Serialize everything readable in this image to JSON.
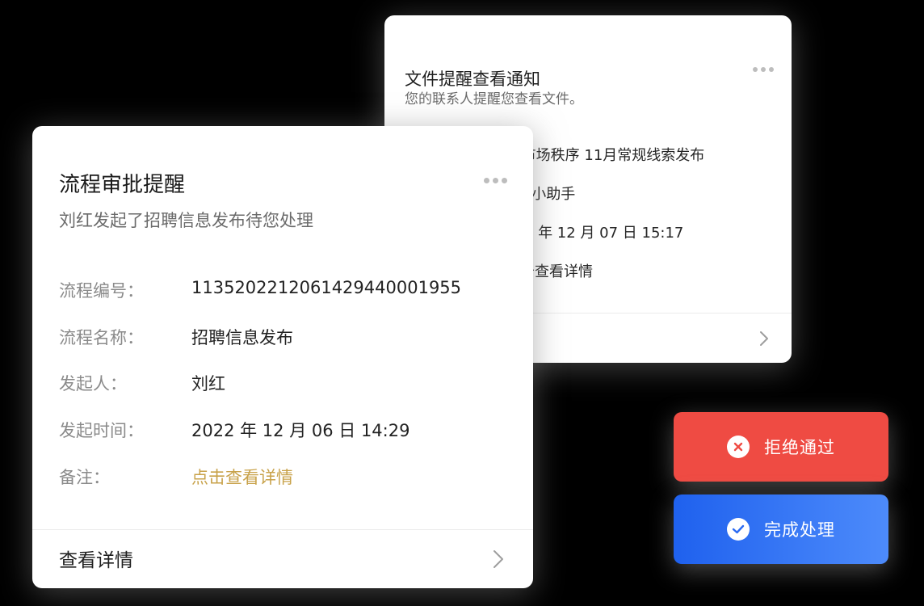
{
  "file_card": {
    "title": "文件提醒查看通知",
    "subtitle": "您的联系人提醒您查看文件。",
    "rows": [
      "G 市场秩序 11月常规线索发布",
      "CG 小助手",
      "022 年 12 月 07 日 15:17",
      "点击查看详情"
    ]
  },
  "approval_card": {
    "title": "流程审批提醒",
    "subtitle": "刘红发起了招聘信息发布待您处理",
    "fields": [
      {
        "label": "流程编号：",
        "value": "1135202212061429440001955"
      },
      {
        "label": "流程名称：",
        "value": "招聘信息发布"
      },
      {
        "label": "发起人：",
        "value": "刘红"
      },
      {
        "label": "发起时间：",
        "value": "2022 年 12 月 06 日 14:29"
      },
      {
        "label": "备注：",
        "value": "点击查看详情"
      }
    ],
    "footer_label": "查看详情"
  },
  "actions": {
    "reject_label": "拒绝通过",
    "complete_label": "完成处理"
  },
  "colors": {
    "reject": "#ef4b43",
    "complete_start": "#1f61ee",
    "complete_end": "#4d8bfb",
    "link": "#c8a24a"
  },
  "icons": {
    "more": "more-dots-icon",
    "chevron": "chevron-right-icon",
    "reject": "close-circle-icon",
    "complete": "check-circle-icon"
  }
}
